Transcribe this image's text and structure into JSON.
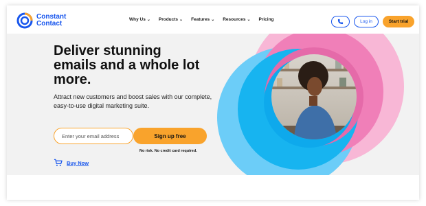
{
  "brand": {
    "name_line1": "Constant",
    "name_line2": "Contact",
    "logo_icon": "constant-contact-logo"
  },
  "nav": {
    "items": [
      {
        "label": "Why Us",
        "has_menu": true
      },
      {
        "label": "Products",
        "has_menu": true
      },
      {
        "label": "Features",
        "has_menu": true
      },
      {
        "label": "Resources",
        "has_menu": true
      },
      {
        "label": "Pricing",
        "has_menu": false
      }
    ],
    "phone_icon": "phone-icon",
    "login_label": "Log in",
    "trial_label": "Start trial"
  },
  "hero": {
    "headline": "Deliver stunning emails and a whole lot more.",
    "subhead": "Attract new customers and boost sales with our complete, easy-to-use digital marketing suite.",
    "email_placeholder": "Enter your email address",
    "signup_label": "Sign up free",
    "risk_note": "No risk. No credit card required.",
    "buy_now_label": "Buy Now",
    "cart_icon": "cart-icon"
  },
  "colors": {
    "brand_blue": "#1856ed",
    "accent_orange": "#f9a32c",
    "circle_blue": "#4cc0f5",
    "circle_pink": "#f48cbf",
    "background": "#f2f2f2"
  }
}
